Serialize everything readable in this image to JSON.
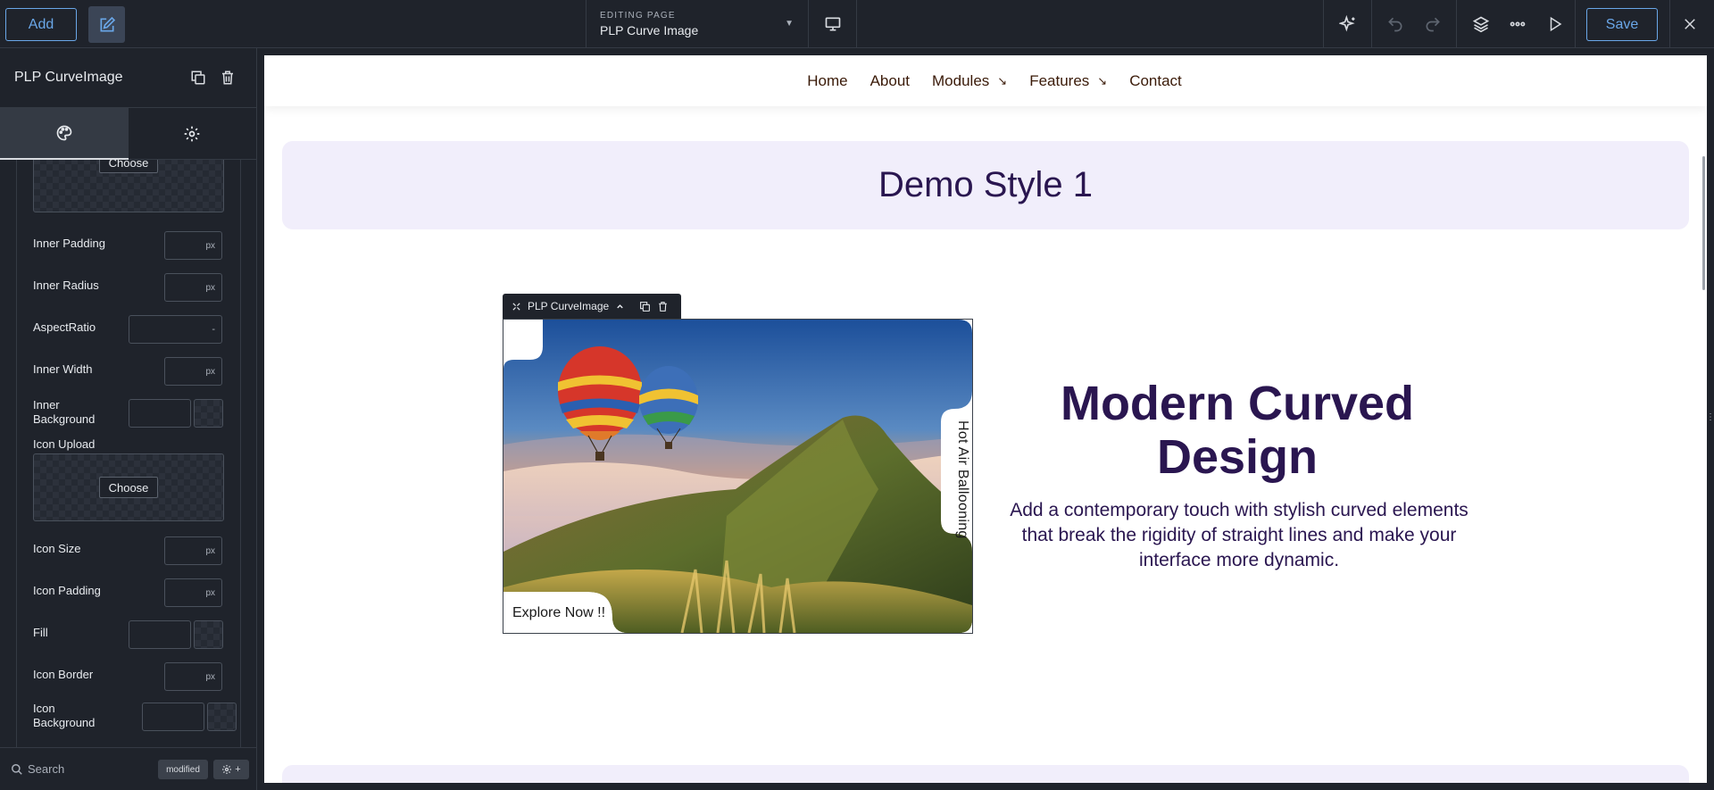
{
  "topbar": {
    "add_label": "Add",
    "editing_label": "EDITING PAGE",
    "editing_value": "PLP Curve Image",
    "save_label": "Save"
  },
  "panel": {
    "title": "PLP CurveImage",
    "choose_top_label": "Choose",
    "fields": {
      "inner_padding": {
        "label": "Inner Padding",
        "unit": "px"
      },
      "inner_radius": {
        "label": "Inner Radius",
        "unit": "px"
      },
      "aspect_ratio": {
        "label": "AspectRatio",
        "value": "-"
      },
      "inner_width": {
        "label": "Inner Width",
        "unit": "px"
      },
      "inner_background": {
        "label": "Inner Background"
      },
      "icon_upload": {
        "label": "Icon Upload",
        "choose_label": "Choose"
      },
      "icon_size": {
        "label": "Icon Size",
        "unit": "px"
      },
      "icon_padding": {
        "label": "Icon Padding",
        "unit": "px"
      },
      "fill": {
        "label": "Fill"
      },
      "icon_border": {
        "label": "Icon Border",
        "unit": "px"
      },
      "icon_background": {
        "label": "Icon Background"
      }
    },
    "footer": {
      "search_placeholder": "Search",
      "badge_label": "modified",
      "add_symbol": "+"
    }
  },
  "canvas": {
    "nav": [
      {
        "label": "Home",
        "arrow": ""
      },
      {
        "label": "About",
        "arrow": ""
      },
      {
        "label": "Modules",
        "arrow": "↘"
      },
      {
        "label": "Features",
        "arrow": "↘"
      },
      {
        "label": "Contact",
        "arrow": ""
      }
    ],
    "demo_title": "Demo Style 1",
    "selection_label": "PLP CurveImage",
    "image": {
      "side_label": "Hot Air Ballooning",
      "cta_label": "Explore Now !!"
    },
    "hero_title": "Modern Curved Design",
    "hero_desc": "Add a contemporary touch with stylish curved elements that break the rigidity of straight lines and make your interface more dynamic."
  },
  "colors": {
    "accent": "#6aa7e8",
    "chrome_bg": "#1f232b",
    "heading": "#2a1650",
    "demo_bg": "#f1eefb",
    "nav_text": "#3a1a08"
  }
}
